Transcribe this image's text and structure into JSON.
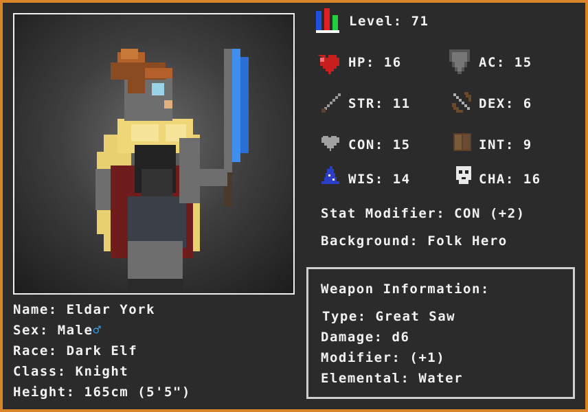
{
  "stats": {
    "level": "Level: 71",
    "hp": "HP: 16",
    "ac": "AC: 15",
    "str": "STR: 11",
    "dex": "DEX: 6",
    "con": "CON: 15",
    "int": "INT: 9",
    "wis": "WIS: 14",
    "cha": "CHA: 16",
    "stat_modifier": "Stat Modifier: CON (+2)",
    "background": "Background: Folk Hero"
  },
  "character": {
    "name": "Name: Eldar York",
    "sex": "Sex: Male",
    "sex_symbol": "♂",
    "race": "Race: Dark Elf",
    "class": "Class: Knight",
    "height": "Height: 165cm (5'5\")"
  },
  "weapon": {
    "title": "Weapon Information:",
    "type": "Type: Great Saw",
    "damage": "Damage: d6",
    "modifier": "Modifier: (+1)",
    "elemental": "Elemental: Water"
  },
  "colors": {
    "border": "#d9862b",
    "background": "#2b2b2b",
    "text": "#f2f2f2",
    "male_symbol": "#3a9ee8"
  },
  "icons": [
    "level-bars-icon",
    "heart-icon",
    "shield-icon",
    "sword-icon",
    "bow-icon",
    "grey-heart-icon",
    "book-icon",
    "wizard-hat-icon",
    "mask-icon"
  ]
}
